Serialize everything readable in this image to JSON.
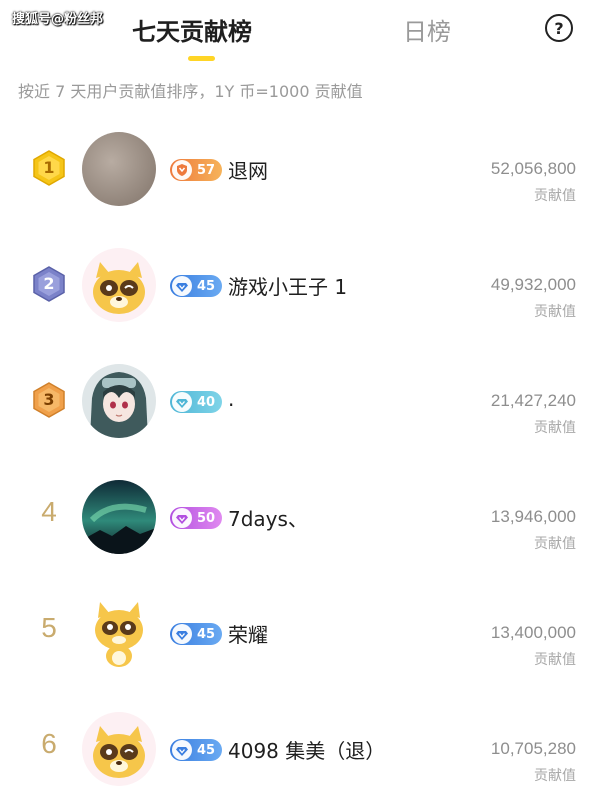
{
  "watermark": "搜狐号@粉丝邦",
  "tabs": {
    "active": "七天贡献榜",
    "inactive": "日榜"
  },
  "help_label": "?",
  "subtitle": "按近 7 天用户贡献值排序，1Y 币=1000 贡献值",
  "colors": {
    "accent": "#ffd526",
    "gold": "#f5c518",
    "silver": "#7b82c9",
    "bronze": "#f0a04a",
    "rank_text": "#c9ab6e"
  },
  "rows": [
    {
      "rank": "1",
      "level": "57",
      "badge_color": "#f0a04a",
      "name": "退网",
      "score": "52,056,800",
      "score_label": "贡献值"
    },
    {
      "rank": "2",
      "level": "45",
      "badge_color": "#4a90e2",
      "name": "游戏小王子 1",
      "score": "49,932,000",
      "score_label": "贡献值"
    },
    {
      "rank": "3",
      "level": "40",
      "badge_color": "#5bc0de",
      "name": ".",
      "score": "21,427,240",
      "score_label": "贡献值"
    },
    {
      "rank": "4",
      "level": "50",
      "badge_color": "#c066e0",
      "name": "7days、",
      "score": "13,946,000",
      "score_label": "贡献值"
    },
    {
      "rank": "5",
      "level": "45",
      "badge_color": "#4a90e2",
      "name": "荣耀",
      "score": "13,400,000",
      "score_label": "贡献值"
    },
    {
      "rank": "6",
      "level": "45",
      "badge_color": "#4a90e2",
      "name": "4098 集美（退）",
      "score": "10,705,280",
      "score_label": "贡献值"
    }
  ]
}
